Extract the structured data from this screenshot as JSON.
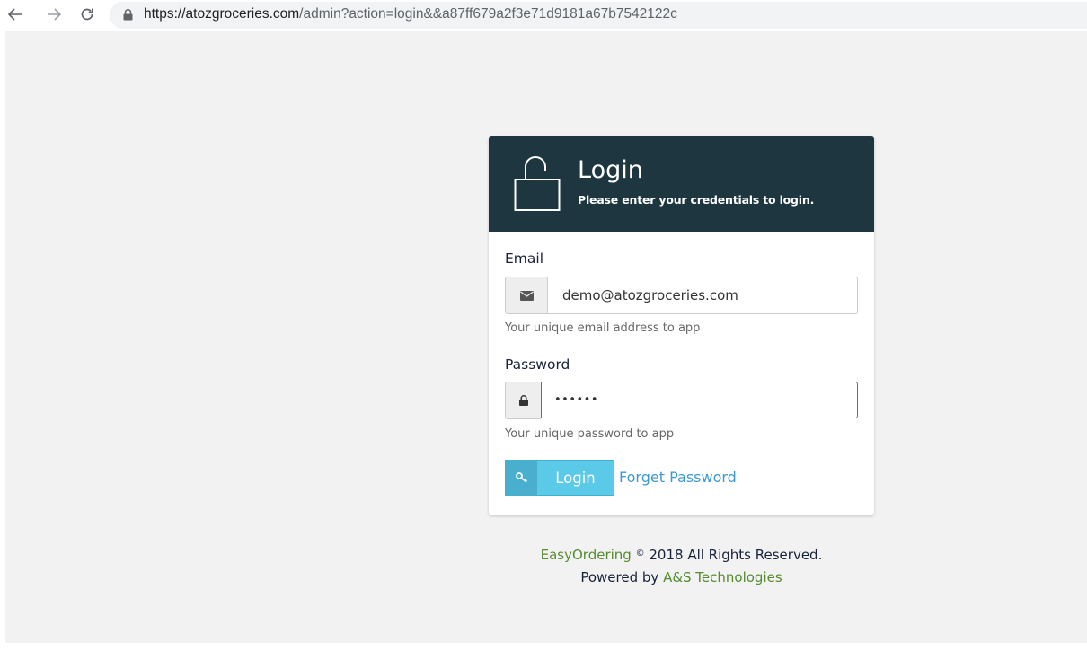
{
  "browser": {
    "url_domain": "https://atozgroceries.com",
    "url_path": "/admin?action=login&&a87ff679a2f3e71d9181a67b7542122c",
    "icons": [
      "back-arrow-icon",
      "forward-arrow-icon",
      "reload-icon",
      "lock-icon"
    ]
  },
  "login": {
    "title": "Login",
    "subtitle": "Please enter your credentials to login.",
    "header_icon": "unlocked-padlock-icon",
    "email": {
      "label": "Email",
      "value": "demo@atozgroceries.com",
      "help": "Your unique email address to app",
      "icon": "envelope-icon"
    },
    "password": {
      "label": "Password",
      "value": "••••••",
      "help": "Your unique password to app",
      "icon": "lock-icon"
    },
    "login_button": {
      "label": "Login",
      "icon": "key-icon"
    },
    "forget_password": "Forget Password"
  },
  "footer": {
    "brand": "EasyOrdering",
    "copyright_symbol": "©",
    "rights": "2018 All Rights Reserved.",
    "powered_by_prefix": "Powered by",
    "company": "A&S Technologies"
  },
  "colors": {
    "header_bg": "#1e3640",
    "button_main": "#5bc9e8",
    "button_icon_bg": "#4aafcf",
    "link": "#3d9ad1",
    "footer_link": "#548c2f",
    "focus_border": "#4f8a2f"
  }
}
